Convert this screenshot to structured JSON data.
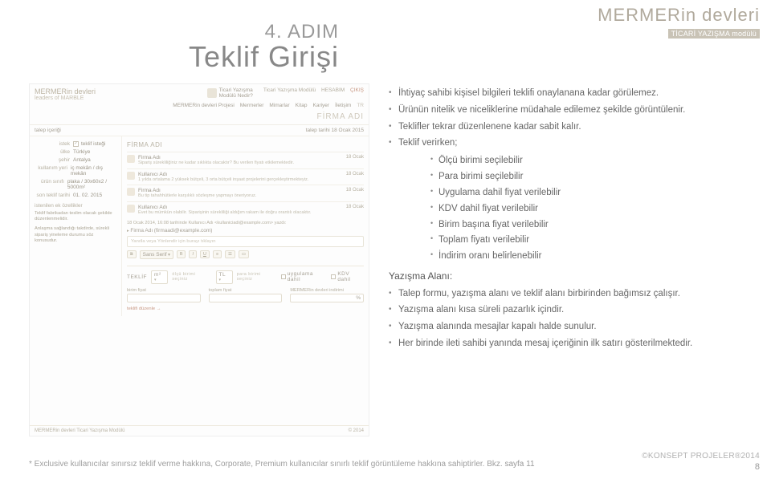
{
  "branding": {
    "product": "MERMERin devleri",
    "module_tag": "TİCARİ YAZIŞMA modülü"
  },
  "step": {
    "label": "4. ADIM",
    "title": "Teklif Girişi"
  },
  "footer": {
    "note": "* Exclusive kullanıcılar sınırsız teklif verme hakkına, Corporate, Premium kullanıcılar sınırlı teklif görüntüleme hakkına sahiptirler. Bkz.",
    "note_link": "sayfa 11",
    "konsept": "©KONSEPT PROJELER®2014",
    "page": "8"
  },
  "bullets": {
    "b1": "İhtiyaç sahibi kişisel bilgileri teklifi onaylanana kadar görülemez.",
    "b2": "Ürünün nitelik ve niceliklerine müdahale edilemez şekilde görüntülenir.",
    "b3": "Teklifler tekrar düzenlenene kadar sabit kalır.",
    "b4": "Teklif verirken;",
    "s1": "Ölçü birimi seçilebilir",
    "s2": "Para birimi seçilebilir",
    "s3": "Uygulama dahil fiyat verilebilir",
    "s4": "KDV dahil fiyat verilebilir",
    "s5": "Birim başına fiyat verilebilir",
    "s6": "Toplam fiyatı verilebilir",
    "s7": "İndirim oranı belirlenebilir",
    "head2": "Yazışma Alanı:",
    "c1": "Talep formu, yazışma alanı ve teklif alanı birbirinden bağımsız çalışır.",
    "c2": "Yazışma alanı kısa süreli pazarlık içindir.",
    "c3": "Yazışma alanında mesajlar kapalı halde sunulur.",
    "c4": "Her birinde ileti sahibi yanında mesaj içeriğinin ilk satırı gösterilmektedir."
  },
  "app": {
    "logo_line1": "MERMERin devleri",
    "logo_line2": "leaders of MARBLE",
    "mod_small1": "Ticari Yazışma",
    "mod_small2": "Modülü Nedir?",
    "link_mod": "Ticari Yazışma Modülü",
    "link_hesap": "HESABIM",
    "link_cikis": "ÇIKIŞ",
    "nav": [
      "MERMERin devleri Projesi",
      "Mermerler",
      "Mimarlar",
      "Kitap",
      "Kariyer",
      "İletişim",
      "TR"
    ],
    "firm_label": "FİRMA ADI",
    "row_talep": "talep içeriği",
    "row_date_lbl": "talep tarihi",
    "row_date_val": "18 Ocak 2015",
    "side": {
      "istek_l": "istek",
      "istek_v": "teklif isteği",
      "ulke_l": "ülke",
      "ulke_v": "Türkiye",
      "sehir_l": "şehir",
      "sehir_v": "Antalya",
      "kullanim_l": "kullanım yeri",
      "kullanim_v": "iç mekân / dış mekân",
      "urun_l": "ürün sınıfı",
      "urun_v": "plaka / 30x60x2 / 5000m²",
      "son_l": "son teklif tarihi",
      "son_v": "01. 02. 2015",
      "ek_head": "istenilen ek özellikler",
      "note1": "Teklif fabrikadan teslim olacak şekilde düzenlenmelidir.",
      "note2": "Anlaşma sağlandığı takdirde, sürekli sipariş yineleme durumu söz konusudur."
    },
    "main_head": "FİRMA ADI",
    "items": [
      {
        "title": "Firma Adı",
        "desc": "Sipariş sürekliliğiniz ne kadar sıklıkta olacaktır? Bu verilen fiyatı etkilemektedir.",
        "date": "18 Ocak"
      },
      {
        "title": "Kullanıcı Adı",
        "desc": "1 yılda ortalama 2 yüksek bütçeli, 3 orta bütçeli inşaat projelerini gerçekleştirmekteyiz.",
        "date": "18 Ocak"
      },
      {
        "title": "Firma Adı",
        "desc": "Bu tip tahahhütlerle karşılıklı sözleşme yapmayı öneriyoruz.",
        "date": "18 Ocak"
      },
      {
        "title": "Kullanıcı Adı",
        "desc": "Evet bu mümkün olabilir. Siparişinin sürekliliği aldığım rakam ile doğru orantılı olacaktır.",
        "date": "18 Ocak"
      }
    ],
    "quote_line": "18 Ocak 2014, 16:08 tarihinde Kullanıcı Adı <kullaniciadi@example.com> yazdı:",
    "reply_from_lbl": "Firma Adı",
    "reply_from_mail": "(firmaadi@example.com)",
    "reply_placeholder": "Yanıtla veya Yönlendir için burayı tıklayın",
    "tool_b": "B",
    "tool_font": "Sans Serif",
    "tool_fmt": [
      "B",
      "I",
      "U"
    ],
    "teklif_head": "TEKLİF",
    "sel1": "m²",
    "sel1_ph": "ölçü birimi seçiniz",
    "sel2": "TL",
    "sel2_ph": "para birimi seçiniz",
    "chk_uy": "uygulama dahil",
    "chk_kdv": "KDV dahil",
    "col1": "birim fiyat",
    "col2": "toplam fiyat",
    "col3": "MERMERin devleri indirimi",
    "pct": "%",
    "duzenle": "teklifi düzenle →",
    "foot_l": "MERMERin devleri Ticari Yazışma Modülü",
    "foot_r": "© 2014"
  }
}
